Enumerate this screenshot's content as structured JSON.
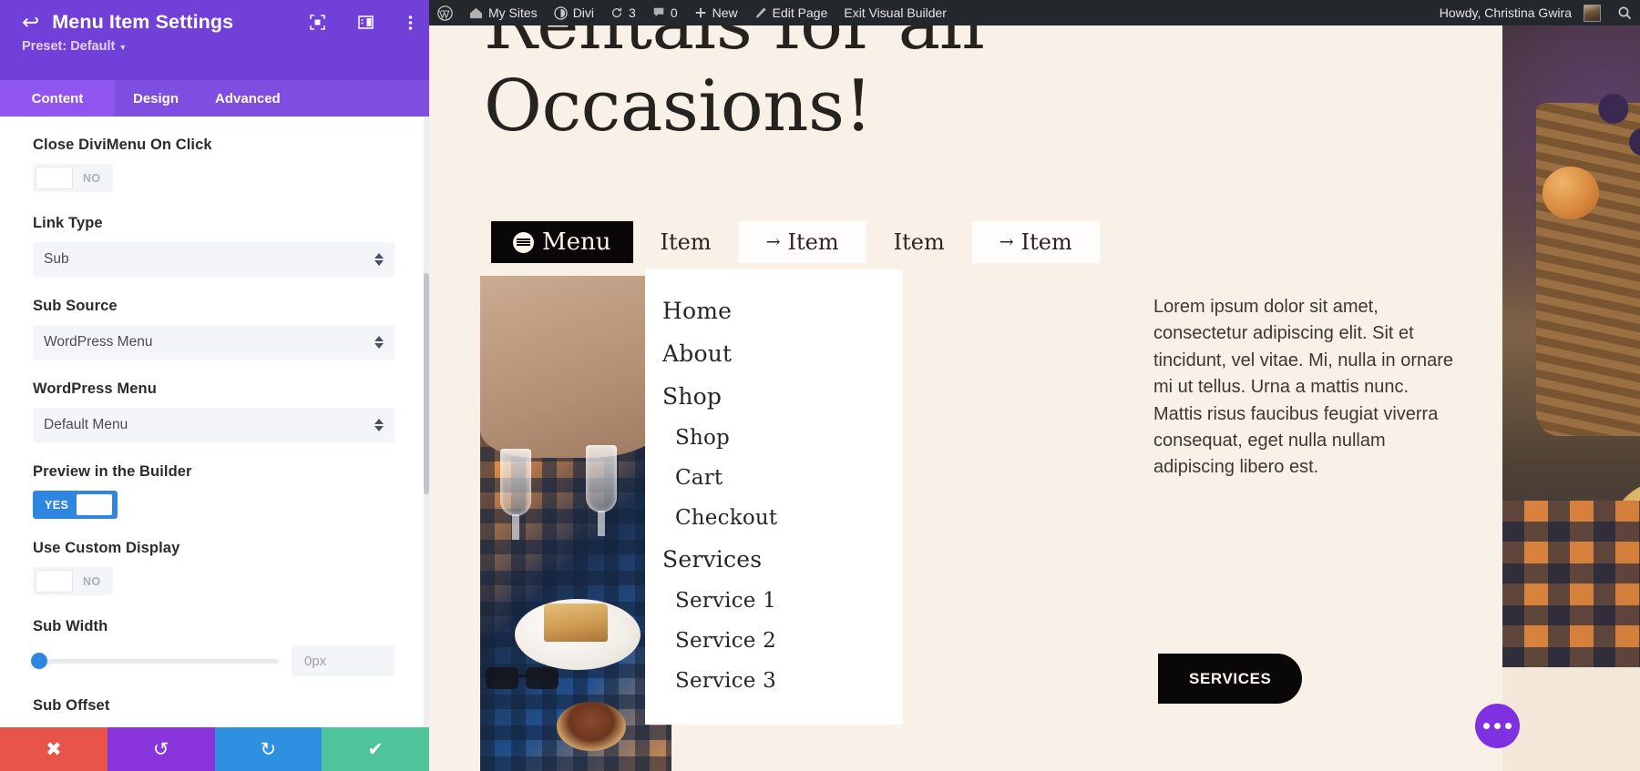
{
  "settings_panel": {
    "title": "Menu Item Settings",
    "preset_label": "Preset: Default",
    "back_icon": "back-arrow-icon",
    "header_icons": [
      "focus-target-icon",
      "panel-layout-icon",
      "more-vertical-icon"
    ],
    "tabs": [
      {
        "label": "Content",
        "active": true
      },
      {
        "label": "Design",
        "active": false
      },
      {
        "label": "Advanced",
        "active": false
      }
    ],
    "fields": {
      "close_divimenu": {
        "label": "Close DiviMenu On Click",
        "value": "NO",
        "on": false
      },
      "link_type": {
        "label": "Link Type",
        "value": "Sub"
      },
      "sub_source": {
        "label": "Sub Source",
        "value": "WordPress Menu"
      },
      "wordpress_menu": {
        "label": "WordPress Menu",
        "value": "Default Menu"
      },
      "preview_builder": {
        "label": "Preview in the Builder",
        "value": "YES",
        "on": true
      },
      "use_custom_display": {
        "label": "Use Custom Display",
        "value": "NO",
        "on": false
      },
      "sub_width": {
        "label": "Sub Width",
        "value": "0px"
      },
      "sub_offset": {
        "label": "Sub Offset"
      }
    },
    "footer": {
      "cancel": "✖",
      "undo": "↺",
      "redo": "↻",
      "save": "✔"
    }
  },
  "admin_bar": {
    "left_items": [
      {
        "label": "",
        "icon": "wordpress-logo-icon"
      },
      {
        "label": "My Sites",
        "icon": "sites-icon"
      },
      {
        "label": "Divi",
        "icon": "divi-icon"
      },
      {
        "label": "3",
        "icon": "updates-icon"
      },
      {
        "label": "0",
        "icon": "comments-icon"
      },
      {
        "label": "New",
        "icon": "plus-icon"
      },
      {
        "label": "Edit Page",
        "icon": "pencil-icon"
      },
      {
        "label": "Exit Visual Builder",
        "icon": ""
      }
    ],
    "account": "Howdy, Christina Gwira",
    "search_icon": "search-icon"
  },
  "page": {
    "hero_title": "Rentals for all Occasions!",
    "menu": {
      "toggle_label": "Menu",
      "toggle_icon": "hamburger-circle-icon",
      "items": [
        {
          "label": "Item",
          "boxed": false,
          "arrow": ""
        },
        {
          "label": "Item",
          "boxed": true,
          "arrow": "→"
        },
        {
          "label": "Item",
          "boxed": false,
          "arrow": ""
        },
        {
          "label": "Item",
          "boxed": true,
          "arrow": "→"
        }
      ]
    },
    "dropdown": [
      {
        "label": "Home",
        "sub": false
      },
      {
        "label": "About",
        "sub": false
      },
      {
        "label": "Shop",
        "sub": false
      },
      {
        "label": "Shop",
        "sub": true
      },
      {
        "label": "Cart",
        "sub": true
      },
      {
        "label": "Checkout",
        "sub": true
      },
      {
        "label": "Services",
        "sub": false
      },
      {
        "label": "Service 1",
        "sub": true
      },
      {
        "label": "Service 2",
        "sub": true
      },
      {
        "label": "Service 3",
        "sub": true
      }
    ],
    "body_text": "Lorem ipsum dolor sit amet, consectetur adipiscing elit. Sit et tincidunt, vel vitae. Mi, nulla in ornare mi ut tellus. Urna a mattis nunc. Mattis risus faucibus feugiat viverra consequat, eget nulla nullam adipiscing libero est.",
    "services_button": "SERVICES",
    "fab_icon": "more-options-icon"
  },
  "colors": {
    "panel_header": "#7140d8",
    "tab_active": "#9055ee",
    "toggle_on": "#2f86e0",
    "admin_bar": "#23282d",
    "page_bg": "#f9f1e8",
    "accent_dark": "#0a0708",
    "fab": "#7f30e0"
  }
}
